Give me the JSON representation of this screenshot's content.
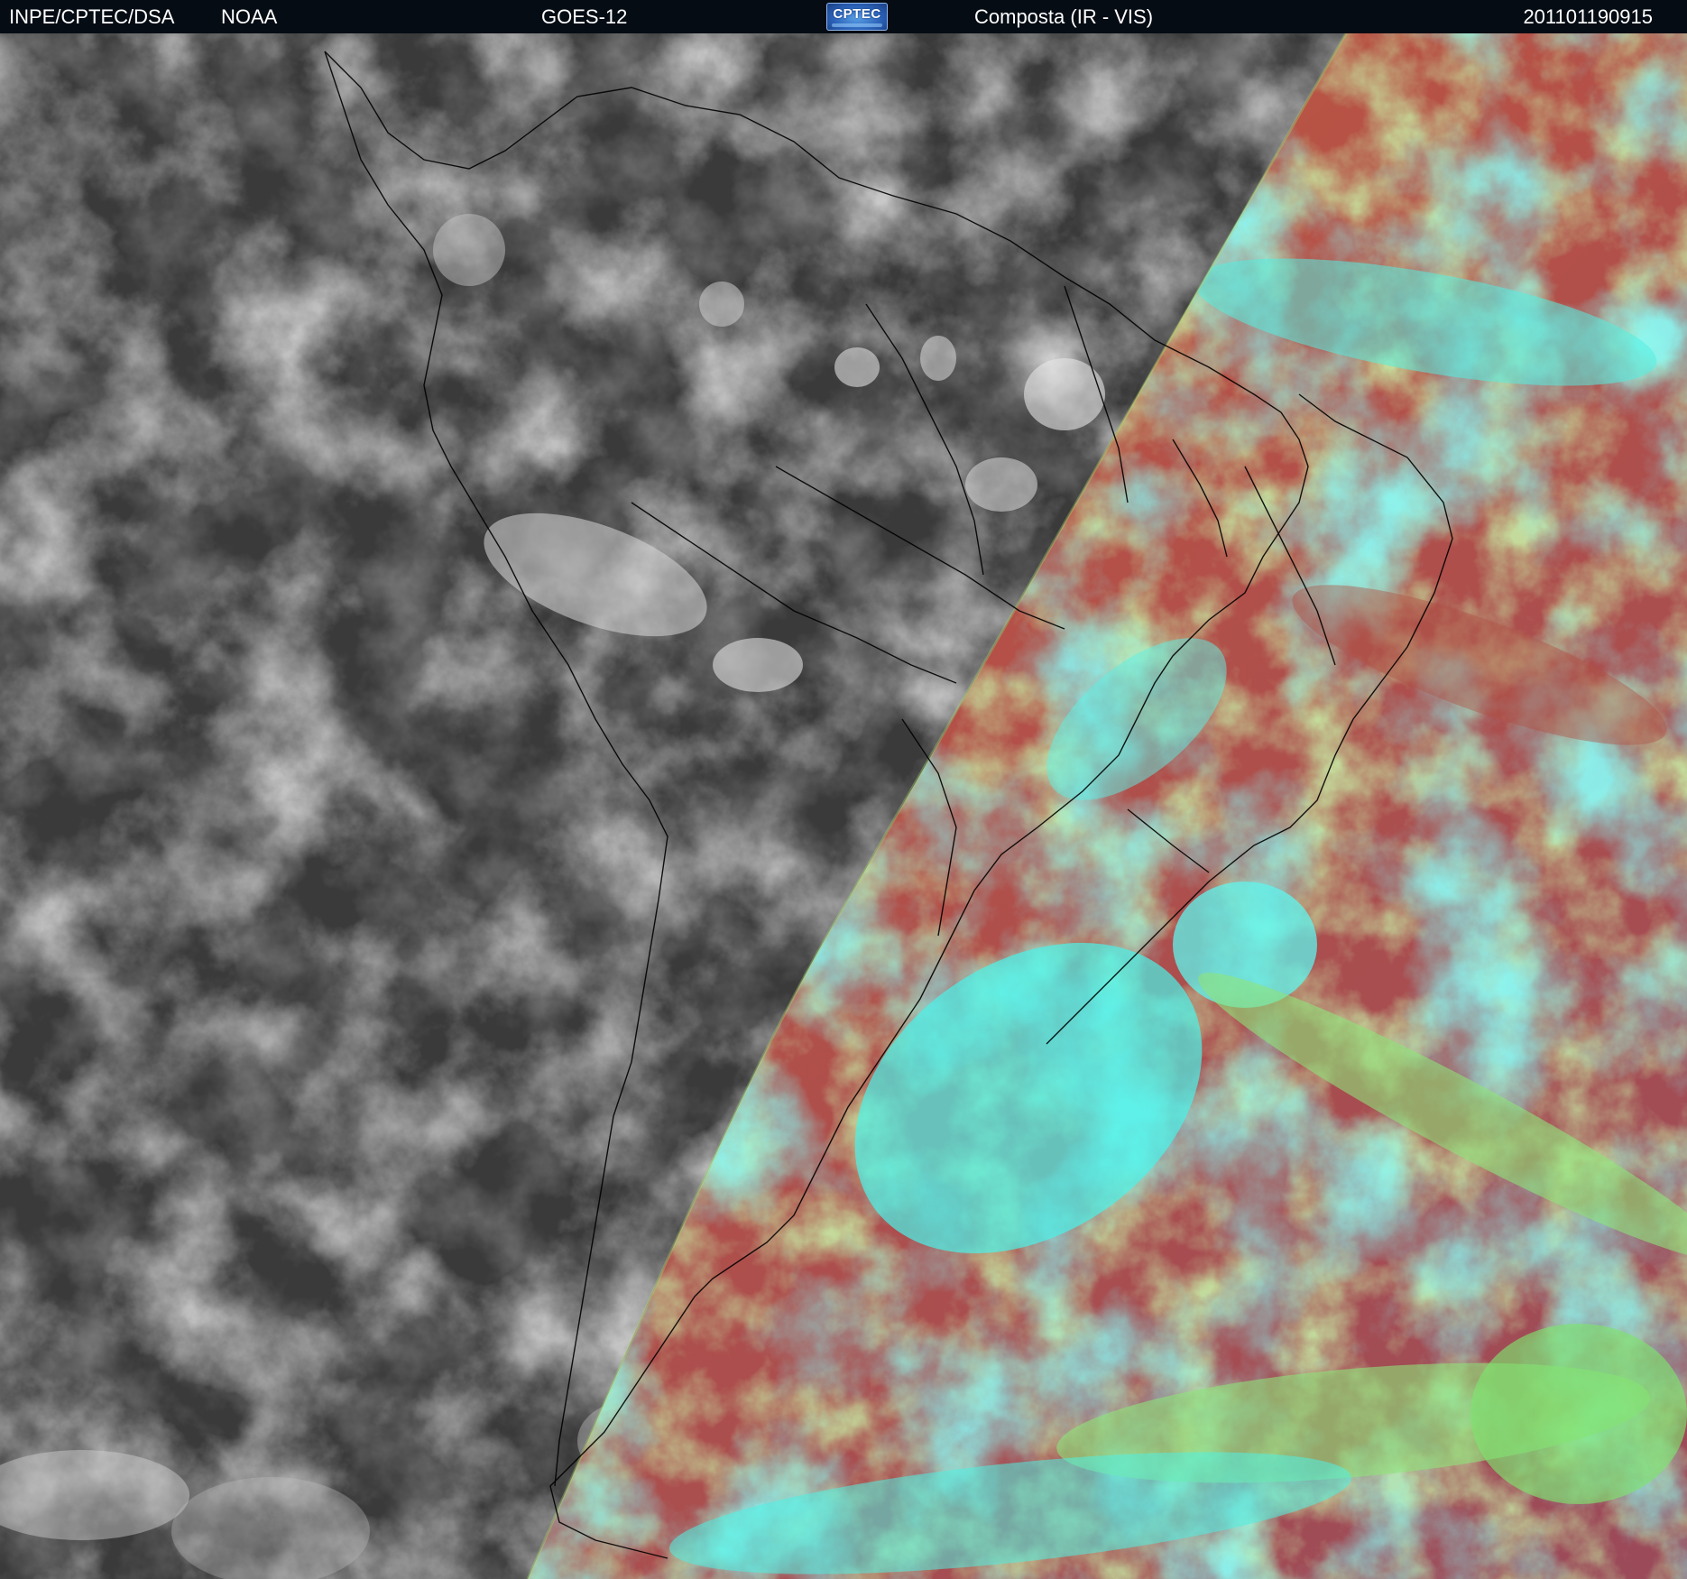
{
  "header": {
    "org": "INPE/CPTEC/DSA",
    "agency": "NOAA",
    "satellite": "GOES-12",
    "logo_text": "CPTEC",
    "product": "Composta (IR - VIS)",
    "timestamp": "201101190915"
  },
  "colors": {
    "header_bg": "#060c14",
    "ir_dark": "#3a3a3a",
    "ir_cloud": "#c8c8c8",
    "vis_clear_sea": "#b85548",
    "vis_high_cloud": "#3cf0e6",
    "vis_low_cloud": "#8ce66a",
    "coastline": "#000000"
  }
}
